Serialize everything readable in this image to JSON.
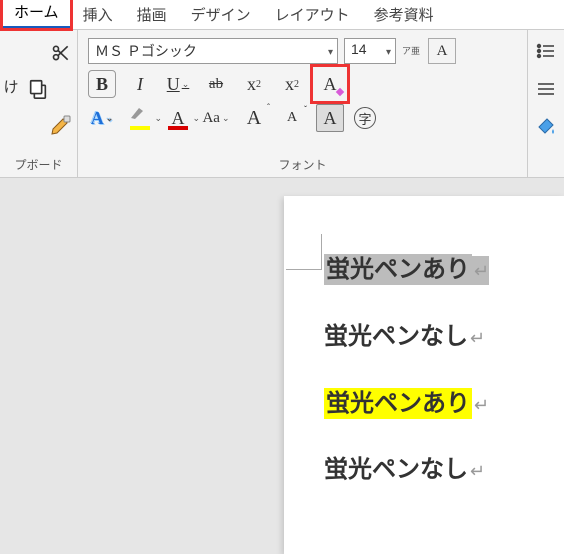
{
  "tabs": {
    "home": "ホーム",
    "insert": "挿入",
    "draw": "描画",
    "design": "デザイン",
    "layout": "レイアウト",
    "references": "参考資料"
  },
  "clipboard": {
    "paste_part": "け",
    "group_label": "プボード"
  },
  "font": {
    "name": "ＭＳ Ｐゴシック",
    "size": "14",
    "ruby_label": "ア亜",
    "bold": "B",
    "italic": "I",
    "underline": "U",
    "strike": "ab",
    "subscript_base": "x",
    "subscript_sub": "2",
    "superscript_base": "x",
    "superscript_sup": "2",
    "clear_fmt": "A",
    "text_effect": "A",
    "highlight": "A",
    "font_color": "A",
    "change_case": "Aa",
    "grow": "A",
    "shrink": "A",
    "shading": "A",
    "char_circle": "字",
    "group_label": "フォント"
  },
  "document": {
    "line1": "蛍光ペンあり",
    "line2": "蛍光ペンなし",
    "line3": "蛍光ペンあり",
    "line4": "蛍光ペンなし",
    "ret": "↵"
  }
}
